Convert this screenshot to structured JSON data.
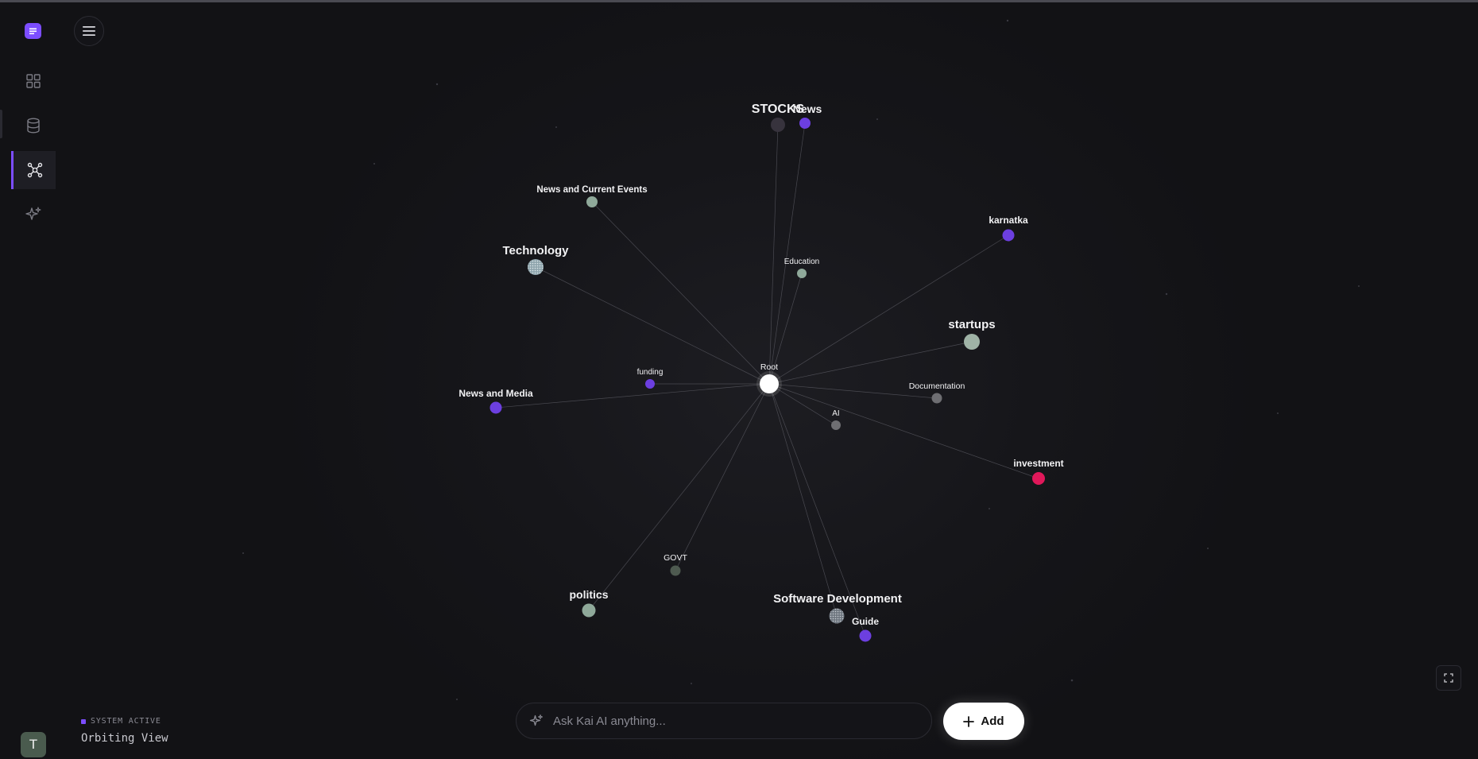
{
  "app": {
    "status_label": "SYSTEM ACTIVE",
    "view_name": "Orbiting View",
    "user_initial": "T"
  },
  "nav": {
    "items": [
      {
        "icon": "grid-icon",
        "active": false
      },
      {
        "icon": "database-icon",
        "active": false
      },
      {
        "icon": "graph-icon",
        "active": true
      },
      {
        "icon": "sparkle-icon",
        "active": false
      }
    ]
  },
  "search": {
    "placeholder": "Ask Kai AI anything...",
    "value": ""
  },
  "toolbar": {
    "add_label": "Add"
  },
  "colors": {
    "accent": "#7c4dff",
    "node_purple": "#6c3fe0",
    "node_green": "#8fa99a",
    "node_gray": "#6e6e72",
    "node_red": "#e0185a",
    "root": "#ffffff"
  },
  "graph": {
    "root": {
      "label": "Root"
    },
    "nodes": [
      {
        "label": "STOCKS"
      },
      {
        "label": "News"
      },
      {
        "label": "News and Current Events"
      },
      {
        "label": "Technology"
      },
      {
        "label": "Education"
      },
      {
        "label": "karnatka"
      },
      {
        "label": "startups"
      },
      {
        "label": "funding"
      },
      {
        "label": "News and Media"
      },
      {
        "label": "Documentation"
      },
      {
        "label": "AI"
      },
      {
        "label": "investment"
      },
      {
        "label": "GOVT"
      },
      {
        "label": "politics"
      },
      {
        "label": "Software Development"
      },
      {
        "label": "Guide"
      }
    ]
  }
}
